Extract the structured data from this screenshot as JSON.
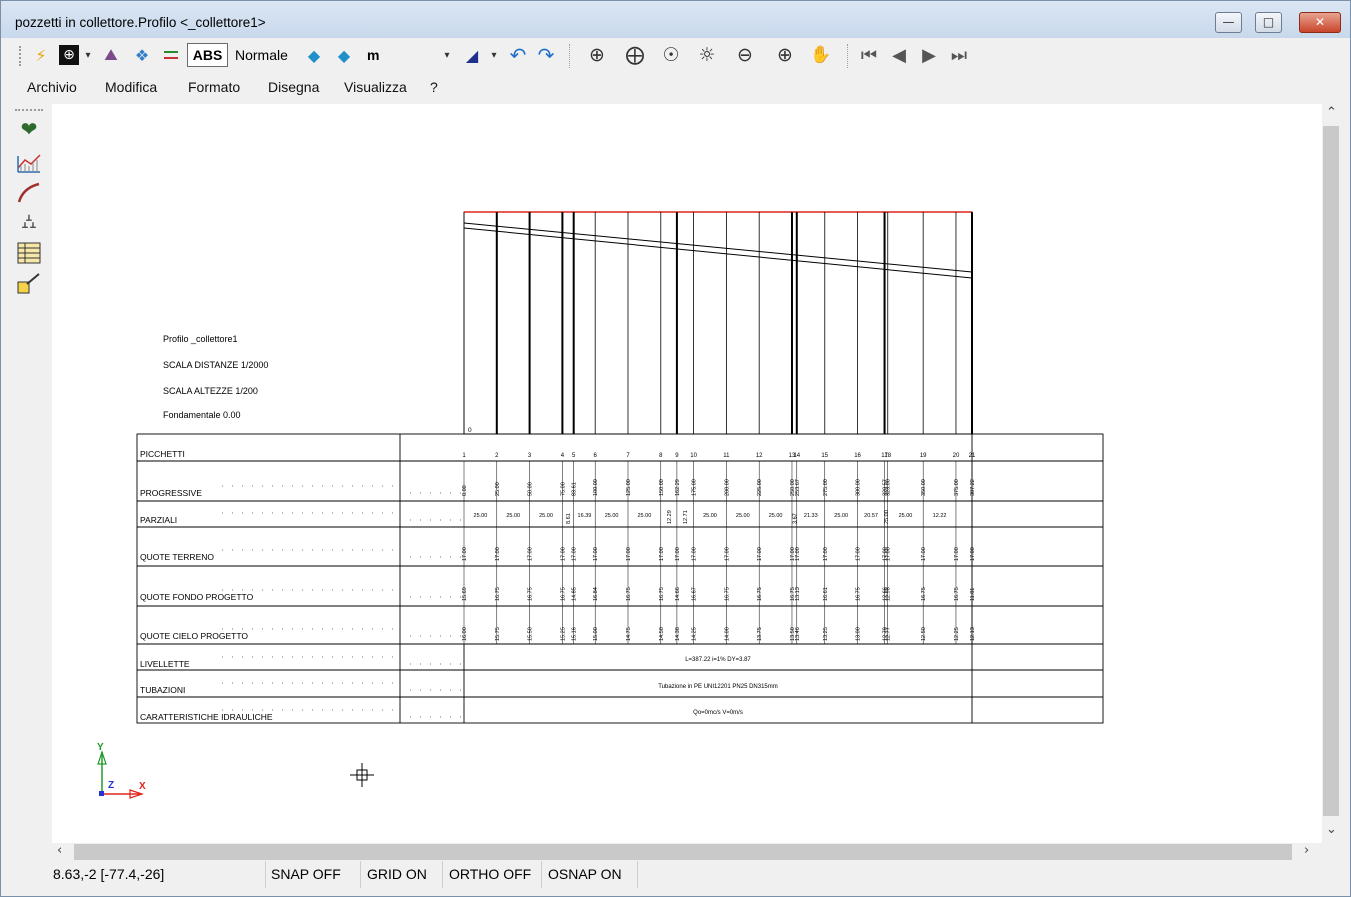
{
  "window": {
    "title": "pozzetti in collettore.Profilo <_collettore1>"
  },
  "toolbar": {
    "abs_label": "ABS",
    "style_label": "Normale",
    "unit_label": "m",
    "icons": [
      "lightning-icon",
      "snap-target-icon",
      "paint-bucket-icon",
      "layers-icon",
      "line-weight-icon",
      "layer-blue-icon",
      "layer-copy-icon",
      "triangle-ruler-icon",
      "undo-icon",
      "redo-icon",
      "zoom-window-icon",
      "zoom-pan-icon",
      "zoom-extents-icon",
      "zoom-realtime-icon",
      "zoom-out-icon",
      "zoom-in-icon",
      "zoom-hand-icon",
      "nav-first-icon",
      "nav-prev-icon",
      "nav-next-icon",
      "nav-last-icon"
    ]
  },
  "menu": {
    "items": [
      "Archivio",
      "Modifica",
      "Formato",
      "Disegna",
      "Visualizza",
      "?"
    ]
  },
  "left_tools": [
    "heart-tool-icon",
    "profile-chart-icon",
    "pipe-curve-icon",
    "manhole-icon",
    "table-grid-icon",
    "edit-node-icon"
  ],
  "drawing": {
    "info": [
      "Profilo _collettore1",
      "SCALA DISTANZE 1/2000",
      "SCALA ALTEZZE 1/200",
      "Fondamentale 0.00"
    ],
    "row_labels": [
      "PICCHETTI",
      "PROGRESSIVE",
      "PARZIALI",
      "QUOTE TERRENO",
      "QUOTE FONDO PROGETTO",
      "QUOTE CIELO PROGETTO",
      "LIVELLETTE",
      "TUBAZIONI",
      "CARATTERISTICHE IDRAULICHE"
    ],
    "picchetti": [
      "1",
      "2",
      "3",
      "4",
      "5",
      "6",
      "7",
      "8",
      "9",
      "10",
      "11",
      "12",
      "13",
      "14",
      "15",
      "16",
      "17",
      "18",
      "19",
      "20",
      "21"
    ],
    "progressive": [
      "0.00",
      "25.00",
      "50.00",
      "75.00",
      "83.61",
      "100.00",
      "125.00",
      "150.00",
      "162.29",
      "175.00",
      "200.00",
      "225.00",
      "250.00",
      "253.67",
      "275.00",
      "300.00",
      "320.57",
      "323.00",
      "350.00",
      "375.00",
      "387.22"
    ],
    "parziali": [
      "25.00",
      "25.00",
      "25.00",
      "8.61",
      "16.39",
      "25.00",
      "25.00",
      "12.29",
      "12.71",
      "25.00",
      "25.00",
      "25.00",
      "3.67",
      "21.33",
      "25.00",
      "20.57",
      "25.00",
      "25.00",
      "12.22"
    ],
    "quote_terreno": [
      "17.00",
      "17.00",
      "17.00",
      "17.00",
      "17.00",
      "17.00",
      "17.00",
      "17.00",
      "17.00",
      "17.00",
      "17.00",
      "17.00",
      "17.00",
      "17.00",
      "17.00",
      "17.00",
      "17.00",
      "17.00",
      "17.00",
      "17.00",
      "17.00"
    ],
    "quote_fondo": [
      "15.69",
      "16.75",
      "16.75",
      "16.75",
      "14.85",
      "16.84",
      "16.75",
      "16.75",
      "14.66",
      "16.67",
      "16.75",
      "16.75",
      "16.75",
      "13.13",
      "16.61",
      "16.75",
      "12.66",
      "12.98",
      "16.75",
      "16.75",
      "11.81"
    ],
    "quote_cielo": [
      "16.00",
      "15.75",
      "15.50",
      "15.25",
      "15.16",
      "15.00",
      "14.75",
      "14.50",
      "14.38",
      "14.25",
      "14.00",
      "13.75",
      "13.50",
      "13.46",
      "13.25",
      "13.00",
      "12.79",
      "12.77",
      "12.50",
      "12.25",
      "12.13"
    ],
    "livellette_text": "L=387.22 i=1% DY=3.87",
    "tubazioni_text": "Tubazione in PE UNI12201 PN25 DN315mm",
    "caratteristiche_text": "Qo=0mc/s V=0m/s",
    "datum_label": "0",
    "axes": {
      "y": "Y",
      "z": "Z",
      "x": "X"
    }
  },
  "status": {
    "coords": "8.63,-2 [-77.4,-26]",
    "snap": "SNAP OFF",
    "grid": "GRID ON",
    "ortho": "ORTHO OFF",
    "osnap": "OSNAP ON"
  }
}
